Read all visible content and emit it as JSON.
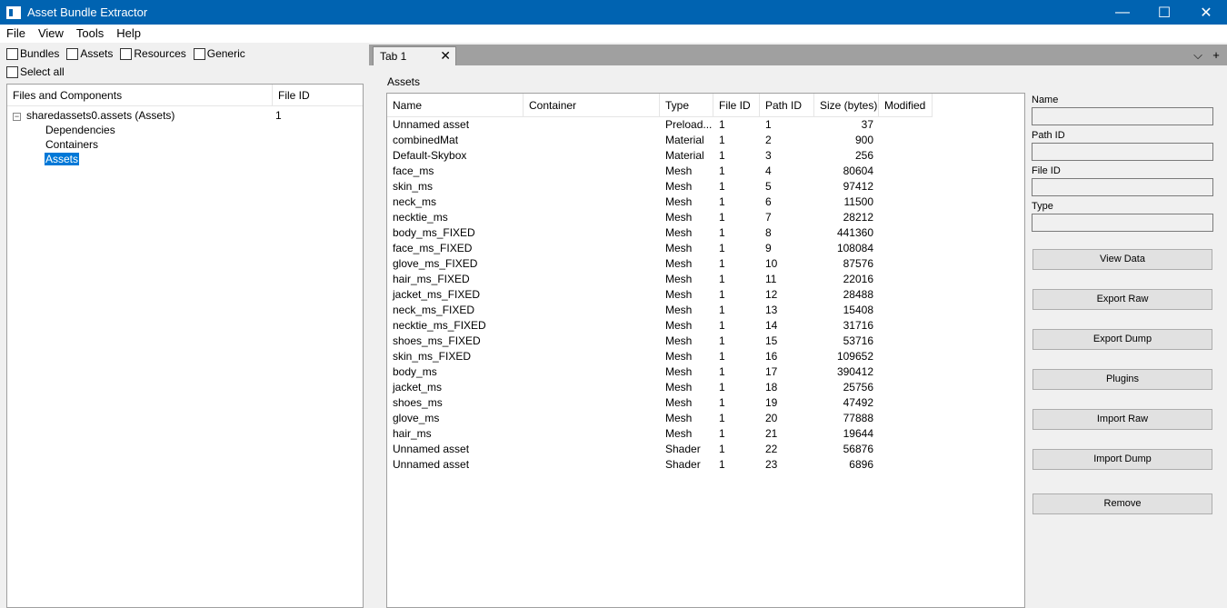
{
  "window": {
    "title": "Asset Bundle Extractor",
    "controls": {
      "minimize": "—",
      "maximize": "☐",
      "close": "✕"
    }
  },
  "menu": [
    "File",
    "View",
    "Tools",
    "Help"
  ],
  "filters": {
    "bundles": "Bundles",
    "assets": "Assets",
    "resources": "Resources",
    "generic": "Generic",
    "select_all": "Select all"
  },
  "tree": {
    "col_files": "Files and Components",
    "col_fileid": "File ID",
    "root": {
      "label": "sharedassets0.assets (Assets)",
      "file_id": "1",
      "expander": "−"
    },
    "children": [
      "Dependencies",
      "Containers",
      "Assets"
    ]
  },
  "tabs": {
    "active": "Tab 1",
    "close": "✕",
    "dropdown": "⌵",
    "add": "+"
  },
  "assets_section_label": "Assets",
  "table": {
    "headers": [
      "Name",
      "Container",
      "Type",
      "File ID",
      "Path ID",
      "Size (bytes)",
      "Modified"
    ],
    "rows": [
      [
        "Unnamed asset",
        "",
        "Preload...",
        "1",
        "1",
        "37",
        ""
      ],
      [
        "combinedMat",
        "",
        "Material",
        "1",
        "2",
        "900",
        ""
      ],
      [
        "Default-Skybox",
        "",
        "Material",
        "1",
        "3",
        "256",
        ""
      ],
      [
        "face_ms",
        "",
        "Mesh",
        "1",
        "4",
        "80604",
        ""
      ],
      [
        "skin_ms",
        "",
        "Mesh",
        "1",
        "5",
        "97412",
        ""
      ],
      [
        "neck_ms",
        "",
        "Mesh",
        "1",
        "6",
        "11500",
        ""
      ],
      [
        "necktie_ms",
        "",
        "Mesh",
        "1",
        "7",
        "28212",
        ""
      ],
      [
        "body_ms_FIXED",
        "",
        "Mesh",
        "1",
        "8",
        "441360",
        ""
      ],
      [
        "face_ms_FIXED",
        "",
        "Mesh",
        "1",
        "9",
        "108084",
        ""
      ],
      [
        "glove_ms_FIXED",
        "",
        "Mesh",
        "1",
        "10",
        "87576",
        ""
      ],
      [
        "hair_ms_FIXED",
        "",
        "Mesh",
        "1",
        "11",
        "22016",
        ""
      ],
      [
        "jacket_ms_FIXED",
        "",
        "Mesh",
        "1",
        "12",
        "28488",
        ""
      ],
      [
        "neck_ms_FIXED",
        "",
        "Mesh",
        "1",
        "13",
        "15408",
        ""
      ],
      [
        "necktie_ms_FIXED",
        "",
        "Mesh",
        "1",
        "14",
        "31716",
        ""
      ],
      [
        "shoes_ms_FIXED",
        "",
        "Mesh",
        "1",
        "15",
        "53716",
        ""
      ],
      [
        "skin_ms_FIXED",
        "",
        "Mesh",
        "1",
        "16",
        "109652",
        ""
      ],
      [
        "body_ms",
        "",
        "Mesh",
        "1",
        "17",
        "390412",
        ""
      ],
      [
        "jacket_ms",
        "",
        "Mesh",
        "1",
        "18",
        "25756",
        ""
      ],
      [
        "shoes_ms",
        "",
        "Mesh",
        "1",
        "19",
        "47492",
        ""
      ],
      [
        "glove_ms",
        "",
        "Mesh",
        "1",
        "20",
        "77888",
        ""
      ],
      [
        "hair_ms",
        "",
        "Mesh",
        "1",
        "21",
        "19644",
        ""
      ],
      [
        "Unnamed asset",
        "",
        "Shader",
        "1",
        "22",
        "56876",
        ""
      ],
      [
        "Unnamed asset",
        "",
        "Shader",
        "1",
        "23",
        "6896",
        ""
      ]
    ]
  },
  "info": {
    "name_label": "Name",
    "path_id_label": "Path ID",
    "file_id_label": "File ID",
    "type_label": "Type",
    "name_value": "",
    "path_id_value": "",
    "file_id_value": "",
    "type_value": "",
    "buttons": {
      "view_data": "View Data",
      "export_raw": "Export Raw",
      "export_dump": "Export Dump",
      "plugins": "Plugins",
      "import_raw": "Import Raw",
      "import_dump": "Import Dump",
      "remove": "Remove"
    }
  },
  "colors": {
    "titlebar": "#0063b1",
    "selection": "#0078d7",
    "background": "#f0f0f0"
  }
}
